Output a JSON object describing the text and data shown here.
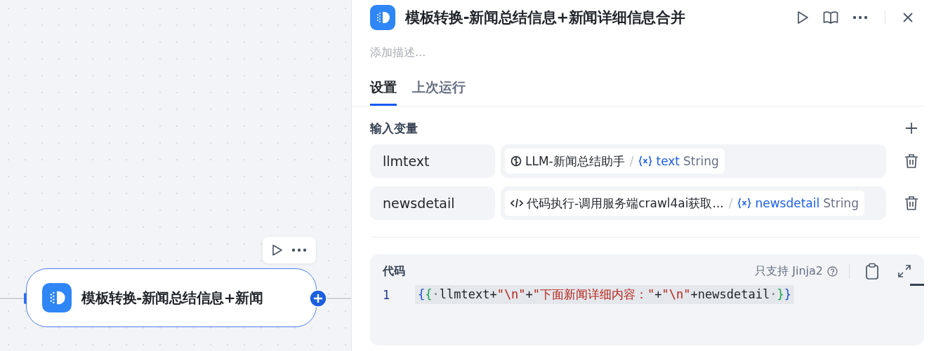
{
  "canvas": {
    "node": {
      "title": "模板转换-新闻总结信息+新闻"
    }
  },
  "panel": {
    "title": "模板转换-新闻总结信息+新闻详细信息合并",
    "description": {
      "placeholder": "添加描述..."
    },
    "tabs": [
      {
        "label": "设置",
        "selected": true
      },
      {
        "label": "上次运行",
        "selected": false
      }
    ],
    "input_variables": {
      "title": "输入变量",
      "rows": [
        {
          "name": "llmtext",
          "kind": "llm",
          "source": "LLM-新闻总结助手",
          "separator": "/",
          "variable": "text",
          "type": "String"
        },
        {
          "name": "newsdetail",
          "kind": "code",
          "source": "代码执行-调用服务端crawl4ai获取...",
          "separator": "/",
          "variable": "newsdetail",
          "type": "String"
        }
      ]
    },
    "code": {
      "title": "代码",
      "hint": "只支持 Jinja2",
      "lines": [
        {
          "number": "1",
          "tokens": [
            {
              "kind": "outer",
              "text": "{"
            },
            {
              "kind": "inner",
              "text": "{"
            },
            {
              "kind": "space",
              "text": "·"
            },
            {
              "kind": "plain",
              "text": "llmtext+"
            },
            {
              "kind": "string",
              "text": "\"\\n\""
            },
            {
              "kind": "plain",
              "text": "+"
            },
            {
              "kind": "string",
              "text": "\"下面新闻详细内容：\""
            },
            {
              "kind": "plain",
              "text": "+"
            },
            {
              "kind": "string",
              "text": "\"\\n\""
            },
            {
              "kind": "plain",
              "text": "+newsdetail"
            },
            {
              "kind": "space",
              "text": "·"
            },
            {
              "kind": "inner",
              "text": "}"
            },
            {
              "kind": "outer",
              "text": "}"
            }
          ]
        }
      ]
    }
  }
}
